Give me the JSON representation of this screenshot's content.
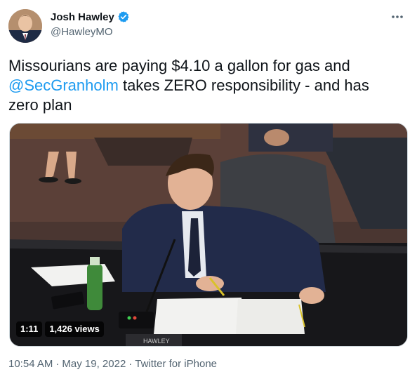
{
  "author": {
    "display_name": "Josh Hawley",
    "handle": "@HawleyMO",
    "verified": true,
    "accent_color": "#1d9bf0"
  },
  "tweet": {
    "text_before": "Missourians are paying $4.10 a gallon for gas and",
    "mention": "@SecGranholm",
    "text_after": " takes ZERO responsibility - and has zero plan"
  },
  "media": {
    "type": "video",
    "duration": "1:11",
    "views": "1,426 views",
    "nameplate_text": "HAWLEY"
  },
  "meta": {
    "time": "10:54 AM",
    "separator": "·",
    "date": "May 19, 2022",
    "source": "Twitter for iPhone"
  },
  "icons": {
    "more": "more-dots-icon",
    "verified": "verified-badge-icon"
  }
}
